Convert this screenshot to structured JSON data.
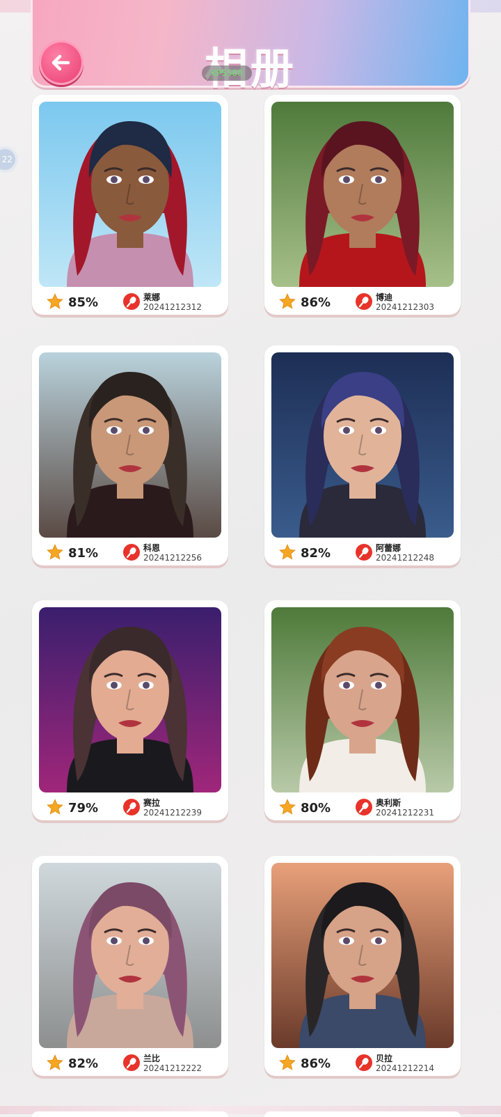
{
  "header": {
    "title": "相册",
    "version_badge": "KPS580"
  },
  "side_bubble": "22",
  "back_button": {
    "icon": "arrow-left-icon"
  },
  "icons": {
    "score": "star-icon",
    "voice": "microphone-icon"
  },
  "colors": {
    "accent_pink": "#ee4f7f",
    "star": "#f5a623",
    "mic": "#e8332a"
  },
  "album": [
    {
      "score": "85%",
      "name": "莱娜",
      "code": "20241212312"
    },
    {
      "score": "86%",
      "name": "博迪",
      "code": "20241212303"
    },
    {
      "score": "81%",
      "name": "科恩",
      "code": "20241212256"
    },
    {
      "score": "82%",
      "name": "阿蕾娜",
      "code": "20241212248"
    },
    {
      "score": "79%",
      "name": "赛拉",
      "code": "20241212239"
    },
    {
      "score": "80%",
      "name": "奥利斯",
      "code": "20241212231"
    },
    {
      "score": "82%",
      "name": "兰比",
      "code": "20241212222"
    },
    {
      "score": "86%",
      "name": "贝拉",
      "code": "20241212214"
    }
  ]
}
